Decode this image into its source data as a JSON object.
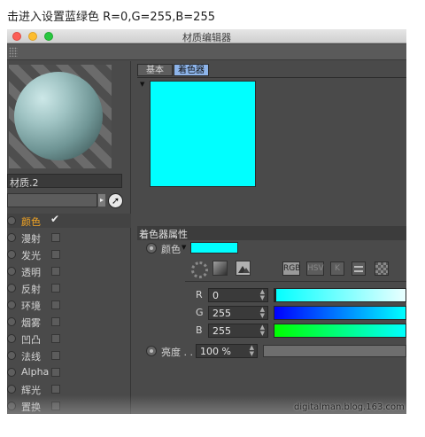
{
  "caption": "击进入设置蓝绿色 R=0,G=255,B=255",
  "window": {
    "title": "材质编辑器"
  },
  "colors": {
    "cyan": "#00ffff",
    "active_channel": "#f5a623",
    "tab_active": "#8db4ea"
  },
  "material": {
    "name": "材质.2"
  },
  "channels": [
    {
      "label": "颜色",
      "checked": true,
      "active": true
    },
    {
      "label": "漫射",
      "checked": false,
      "active": false
    },
    {
      "label": "发光",
      "checked": false,
      "active": false
    },
    {
      "label": "透明",
      "checked": false,
      "active": false
    },
    {
      "label": "反射",
      "checked": false,
      "active": false
    },
    {
      "label": "环境",
      "checked": false,
      "active": false
    },
    {
      "label": "烟雾",
      "checked": false,
      "active": false
    },
    {
      "label": "凹凸",
      "checked": false,
      "active": false
    },
    {
      "label": "法线",
      "checked": false,
      "active": false
    },
    {
      "label": "Alpha",
      "checked": false,
      "active": false
    },
    {
      "label": "辉光",
      "checked": false,
      "active": false
    },
    {
      "label": "置换",
      "checked": false,
      "active": false
    }
  ],
  "tabs": {
    "basic": "基本",
    "color": "着色器"
  },
  "section": {
    "title": "着色器属性"
  },
  "color_prop": {
    "label": "颜色"
  },
  "modes": {
    "rgb": "RGB",
    "hsv": "HSV",
    "k": "K"
  },
  "rgb": {
    "r": {
      "label": "R",
      "value": "0"
    },
    "g": {
      "label": "G",
      "value": "255"
    },
    "b": {
      "label": "B",
      "value": "255"
    }
  },
  "brightness": {
    "label": "亮度 . .",
    "value": "100 %"
  },
  "watermark": "digitalman.blog.163.com",
  "icons": {
    "check": "✔",
    "cursor": "➚",
    "dropdown": "▼",
    "spin": "▲▼",
    "arrow": "▸"
  }
}
